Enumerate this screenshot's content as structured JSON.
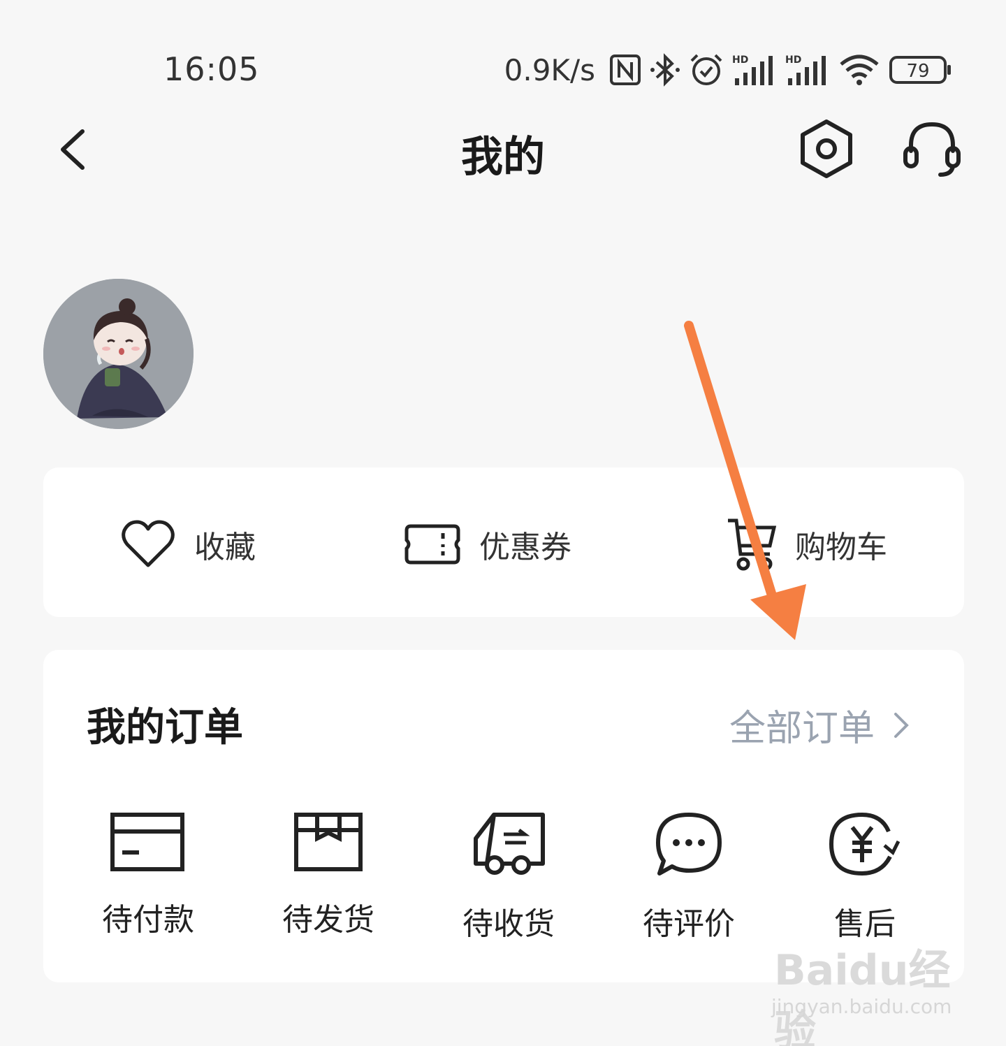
{
  "status_bar": {
    "time": "16:05",
    "net_speed": "0.9K/s",
    "battery": "79",
    "icons": [
      "nfc-icon",
      "bluetooth-icon",
      "alarm-icon",
      "hd-signal-icon",
      "hd-signal-icon",
      "wifi-icon",
      "battery-icon"
    ]
  },
  "nav": {
    "title": "我的",
    "back_icon": "chevron-left-icon",
    "settings_icon": "hexagon-settings-icon",
    "service_icon": "headset-icon"
  },
  "quick_links": [
    {
      "label": "收藏",
      "icon": "heart-icon"
    },
    {
      "label": "优惠券",
      "icon": "coupon-icon"
    },
    {
      "label": "购物车",
      "icon": "cart-icon"
    }
  ],
  "orders": {
    "title": "我的订单",
    "all_label": "全部订单",
    "items": [
      {
        "label": "待付款",
        "icon": "card-icon"
      },
      {
        "label": "待发货",
        "icon": "box-icon"
      },
      {
        "label": "待收货",
        "icon": "truck-icon"
      },
      {
        "label": "待评价",
        "icon": "chat-icon"
      },
      {
        "label": "售后",
        "icon": "yuan-refund-icon"
      }
    ]
  },
  "watermark": {
    "logo": "Baidu经验",
    "url": "jingyan.baidu.com"
  },
  "colors": {
    "background": "#f7f7f7",
    "card": "#ffffff",
    "annotation_arrow": "#f57f42",
    "muted_text": "#9aa3b0"
  }
}
